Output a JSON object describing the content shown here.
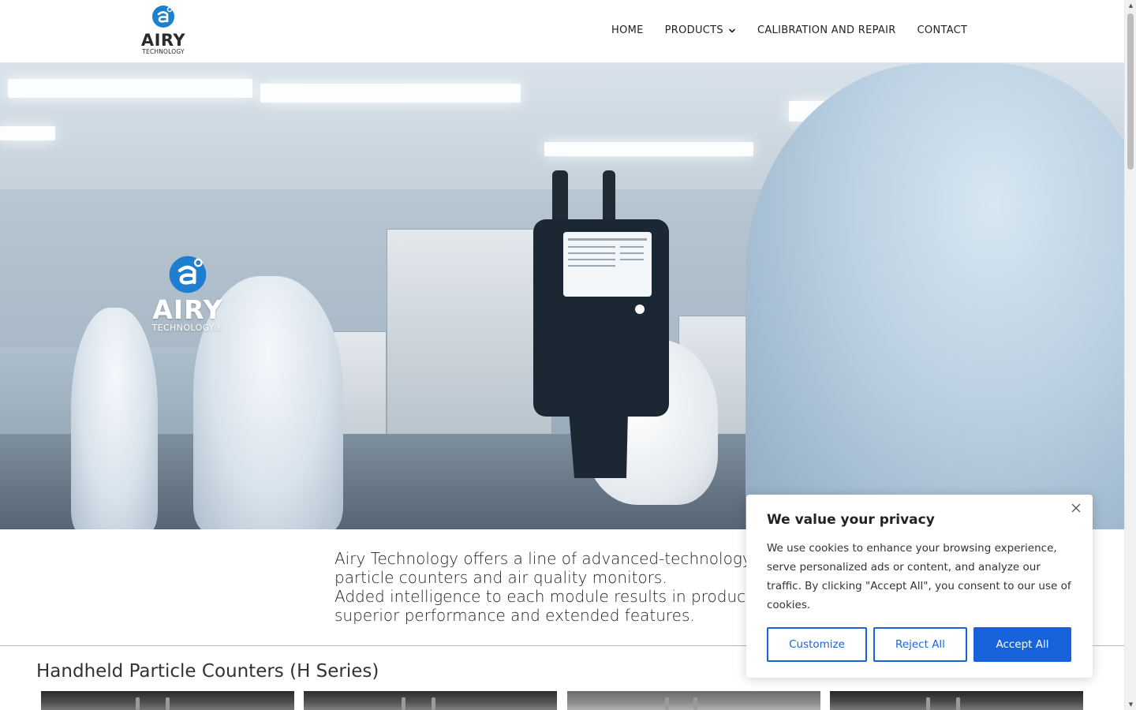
{
  "brand": {
    "name": "AIRY",
    "subtitle": "TECHNOLOGY",
    "hero_subtitle": "TECHNOLOGY®"
  },
  "nav": {
    "items": [
      {
        "label": "HOME"
      },
      {
        "label": "PRODUCTS",
        "has_dropdown": true
      },
      {
        "label": "CALIBRATION AND REPAIR"
      },
      {
        "label": "CONTACT"
      }
    ]
  },
  "intro": {
    "line1": "Airy Technology offers a line of advanced-technology",
    "line2": "particle counters and air quality monitors.",
    "line3": "Added intelligence to each module results in products with",
    "line4": "superior performance and extended features."
  },
  "section": {
    "title": "Handheld Particle Counters (H Series)"
  },
  "cookie": {
    "title": "We value your privacy",
    "text": "We use cookies to enhance your browsing experience, serve personalized ads or content, and analyze our traffic. By clicking \"Accept All\", you consent to our use of cookies.",
    "customize_label": "Customize",
    "reject_label": "Reject All",
    "accept_label": "Accept All"
  },
  "colors": {
    "accent": "#1863dc",
    "logo_blue": "#1e7fd0"
  }
}
